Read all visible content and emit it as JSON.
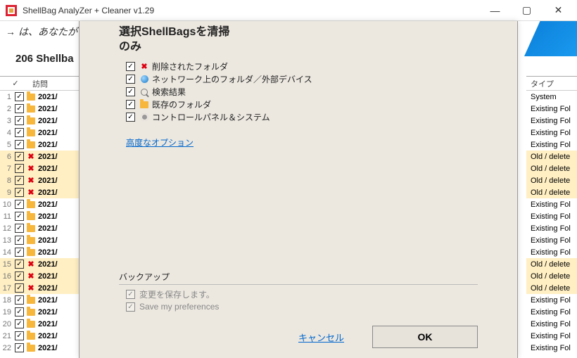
{
  "window": {
    "title": "ShellBag AnalyZer + Cleaner v1.29"
  },
  "header": {
    "prompt": "は、あなたが",
    "count": "206 Shellba"
  },
  "table": {
    "header_check": "✓",
    "header_date": "訪問",
    "header_type": "タイプ",
    "rows": [
      {
        "n": "1",
        "date": "2021/",
        "type": "System",
        "old": false
      },
      {
        "n": "2",
        "date": "2021/",
        "type": "Existing Fol",
        "old": false
      },
      {
        "n": "3",
        "date": "2021/",
        "type": "Existing Fol",
        "old": false
      },
      {
        "n": "4",
        "date": "2021/",
        "type": "Existing Fol",
        "old": false
      },
      {
        "n": "5",
        "date": "2021/",
        "type": "Existing Fol",
        "old": false
      },
      {
        "n": "6",
        "date": "2021/",
        "type": "Old / delete",
        "old": true
      },
      {
        "n": "7",
        "date": "2021/",
        "type": "Old / delete",
        "old": true
      },
      {
        "n": "8",
        "date": "2021/",
        "type": "Old / delete",
        "old": true
      },
      {
        "n": "9",
        "date": "2021/",
        "type": "Old / delete",
        "old": true
      },
      {
        "n": "10",
        "date": "2021/",
        "type": "Existing Fol",
        "old": false
      },
      {
        "n": "11",
        "date": "2021/",
        "type": "Existing Fol",
        "old": false
      },
      {
        "n": "12",
        "date": "2021/",
        "type": "Existing Fol",
        "old": false
      },
      {
        "n": "13",
        "date": "2021/",
        "type": "Existing Fol",
        "old": false
      },
      {
        "n": "14",
        "date": "2021/",
        "type": "Existing Fol",
        "old": false
      },
      {
        "n": "15",
        "date": "2021/",
        "type": "Old / delete",
        "old": true
      },
      {
        "n": "16",
        "date": "2021/",
        "type": "Old / delete",
        "old": true
      },
      {
        "n": "17",
        "date": "2021/",
        "type": "Old / delete",
        "old": true
      },
      {
        "n": "18",
        "date": "2021/",
        "type": "Existing Fol",
        "old": false
      },
      {
        "n": "19",
        "date": "2021/",
        "type": "Existing Fol",
        "old": false
      },
      {
        "n": "20",
        "date": "2021/",
        "type": "Existing Fol",
        "old": false
      },
      {
        "n": "21",
        "date": "2021/",
        "type": "Existing Fol",
        "old": false
      },
      {
        "n": "22",
        "date": "2021/",
        "type": "Existing Fol",
        "old": false
      }
    ]
  },
  "dialog": {
    "title_l1": "選択ShellBagsを清掃",
    "title_l2": "のみ",
    "opts": {
      "deleted": "削除されたフォルダ",
      "network": "ネットワーク上のフォルダ／外部デバイス",
      "search": "検索結果",
      "existing": "既存のフォルダ",
      "control": "コントロールパネル＆システム"
    },
    "advanced": "高度なオプション",
    "backup_title": "バックアップ",
    "backup_save": "変更を保存します。",
    "backup_pref": "Save my preferences",
    "cancel": "キャンセル",
    "ok": "OK"
  }
}
